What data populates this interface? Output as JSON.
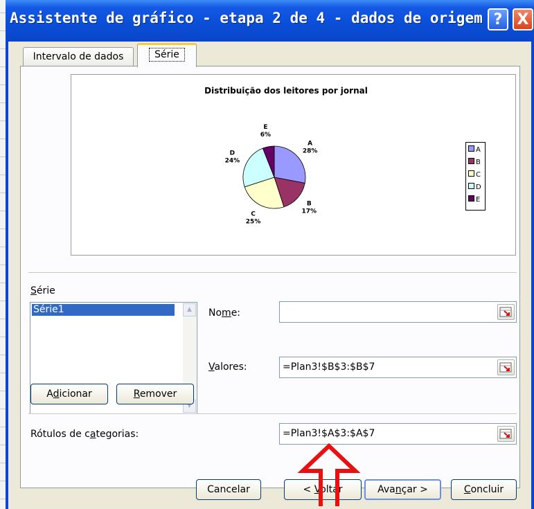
{
  "window": {
    "title": "Assistente de gráfico - etapa 2 de 4 - dados de origem",
    "help_label": "?",
    "close_label": "X"
  },
  "tabs": [
    {
      "label": "Intervalo de dados",
      "selected": false
    },
    {
      "label": "Série",
      "selected": true
    }
  ],
  "chart_data": {
    "type": "pie",
    "title": "Distribuição dos leitores por jornal",
    "categories": [
      "A",
      "B",
      "C",
      "D",
      "E"
    ],
    "values": [
      28,
      17,
      25,
      24,
      6
    ],
    "colors": [
      "#9999ff",
      "#993366",
      "#ffffcc",
      "#ccffff",
      "#660066"
    ],
    "data_labels": [
      "A\n28%",
      "B\n17%",
      "C\n25%",
      "D\n24%",
      "E\n6%"
    ],
    "legend": [
      "A",
      "B",
      "C",
      "D",
      "E"
    ],
    "legend_position": "right"
  },
  "series_section": {
    "label_pre": "",
    "label_key": "S",
    "label_post": "érie",
    "items": [
      "Série1"
    ],
    "selected": "Série1",
    "add_button": {
      "pre": "A",
      "key": "d",
      "post": "icionar"
    },
    "remove_button": {
      "pre": "",
      "key": "R",
      "post": "emover"
    }
  },
  "fields": {
    "name": {
      "pre": "No",
      "key": "m",
      "post": "e:",
      "value": ""
    },
    "values": {
      "pre": "",
      "key": "V",
      "post": "alores:",
      "value": "=Plan3!$B$3:$B$7"
    },
    "categories": {
      "pre": "Rótulos de c",
      "key": "a",
      "post": "tegorias:",
      "value": "=Plan3!$A$3:$A$7"
    }
  },
  "buttons": {
    "cancel": {
      "pre": "Cancelar",
      "key": "",
      "post": ""
    },
    "back": {
      "pre": "< ",
      "key": "V",
      "post": "oltar"
    },
    "next": {
      "pre": "Ava",
      "key": "n",
      "post": "çar >"
    },
    "finish": {
      "pre": "",
      "key": "C",
      "post": "oncluir"
    }
  },
  "annotation": {
    "arrow_color": "#e81010",
    "arrow_direction": "up"
  }
}
